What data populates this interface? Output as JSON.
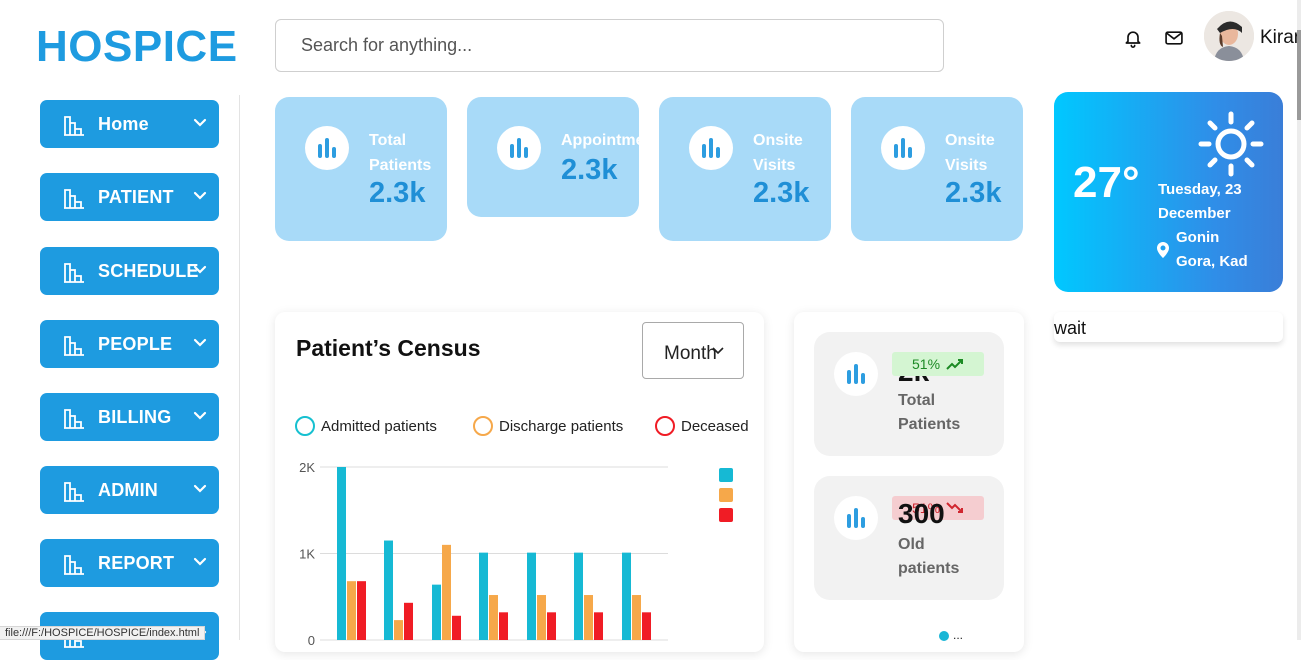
{
  "app": {
    "logo": "HOSPICE"
  },
  "header": {
    "search_placeholder": "Search for anything...",
    "user_name": "Kiran"
  },
  "sidebar": {
    "items": [
      {
        "label": "Home"
      },
      {
        "label": "PATIENT"
      },
      {
        "label": "SCHEDULE"
      },
      {
        "label": "PEOPLE"
      },
      {
        "label": "BILLING"
      },
      {
        "label": "ADMIN"
      },
      {
        "label": "REPORT"
      },
      {
        "label": ""
      }
    ]
  },
  "stats": [
    {
      "label_line1": "Total",
      "label_line2": "Patients",
      "value": "2.3k"
    },
    {
      "label_line1": "Appointme",
      "label_line2": "",
      "value": "2.3k"
    },
    {
      "label_line1": "Onsite",
      "label_line2": "Visits",
      "value": "2.3k"
    },
    {
      "label_line1": "Onsite",
      "label_line2": "Visits",
      "value": "2.3k"
    }
  ],
  "weather": {
    "temperature": "27°",
    "date_line1": "Tuesday, 23",
    "date_line2": "December",
    "location_line1": "Gonin",
    "location_line2": "Gora, Kad"
  },
  "wait_text": "wait",
  "census": {
    "title": "Patient’s Census",
    "period_select": "Month",
    "legend": [
      {
        "label": "Admitted patients",
        "color": "#16c0d0"
      },
      {
        "label": "Discharge patients",
        "color": "#f6a84a"
      },
      {
        "label": "Deceased",
        "color": "#f01c25"
      }
    ]
  },
  "chart_data": {
    "type": "bar",
    "title": "Patient’s Census",
    "xlabel": "",
    "ylabel": "",
    "ylim": [
      0,
      2000
    ],
    "yticks": [
      "2K",
      "1K",
      "0"
    ],
    "grid": true,
    "series": [
      {
        "name": "Admitted patients",
        "color": "#16b9d4",
        "values": [
          2000,
          1150,
          640,
          1010,
          1010,
          1010,
          1010
        ]
      },
      {
        "name": "Discharge patients",
        "color": "#f6a84a",
        "values": [
          680,
          230,
          1100,
          520,
          520,
          520,
          520
        ]
      },
      {
        "name": "Deceased",
        "color": "#f01c25",
        "values": [
          680,
          430,
          280,
          320,
          320,
          320,
          320
        ]
      }
    ],
    "side_legend_colors": [
      "#16b9d4",
      "#f6a84a",
      "#f01c25"
    ]
  },
  "mini_cards": [
    {
      "value": "2k",
      "label_line1": "Total",
      "label_line2": "Patients",
      "badge": "51%",
      "trend": "up"
    },
    {
      "value": "300",
      "label_line1": "Old",
      "label_line2": "patients",
      "badge": "51%",
      "trend": "down"
    }
  ],
  "dots_text": "...",
  "status_url": "file:///F:/HOSPICE/HOSPICE/index.html"
}
